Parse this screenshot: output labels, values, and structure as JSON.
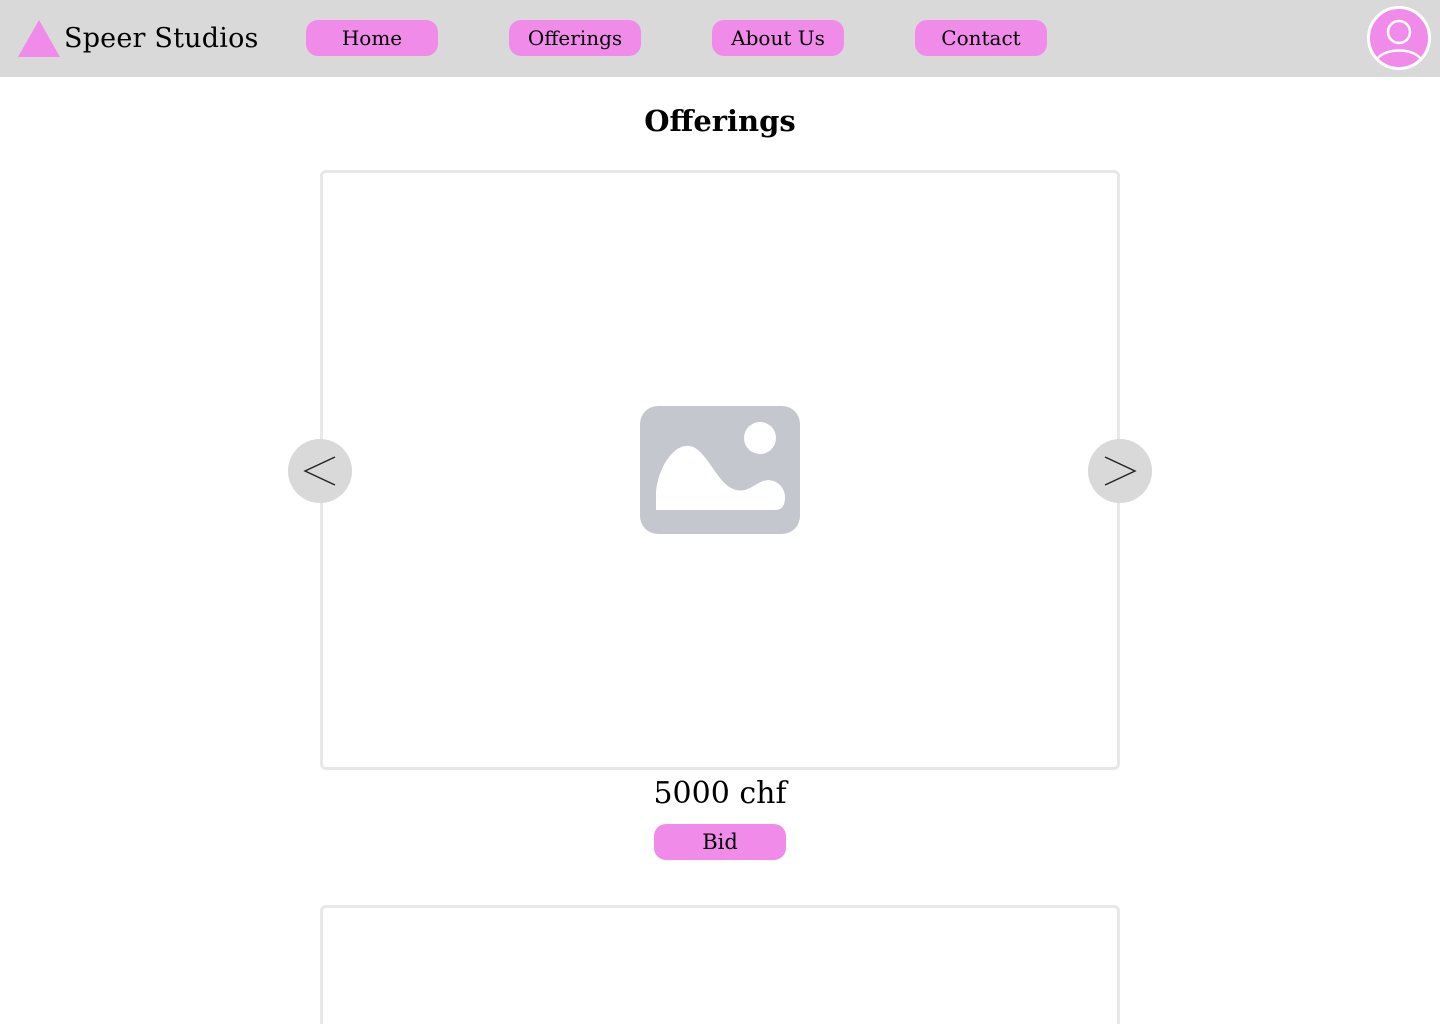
{
  "brand": {
    "name": "Speer Studios",
    "logo_icon": "triangle-logo-icon",
    "accent_color": "#f08bea"
  },
  "nav": {
    "items": [
      {
        "label": "Home"
      },
      {
        "label": "Offerings"
      },
      {
        "label": "About Us"
      },
      {
        "label": "Contact"
      }
    ],
    "avatar_icon": "user-avatar-icon"
  },
  "main": {
    "title": "Offerings",
    "carousel": {
      "prev_icon": "chevron-left-icon",
      "next_icon": "chevron-right-icon",
      "image_icon": "image-placeholder-icon"
    },
    "price": "5000 chf",
    "bid_label": "Bid"
  },
  "colors": {
    "navbar_bg": "#d9d9d9",
    "button_bg": "#f08bea",
    "placeholder_gray": "#c4c8ce",
    "card_border": "#e8e8e8"
  }
}
